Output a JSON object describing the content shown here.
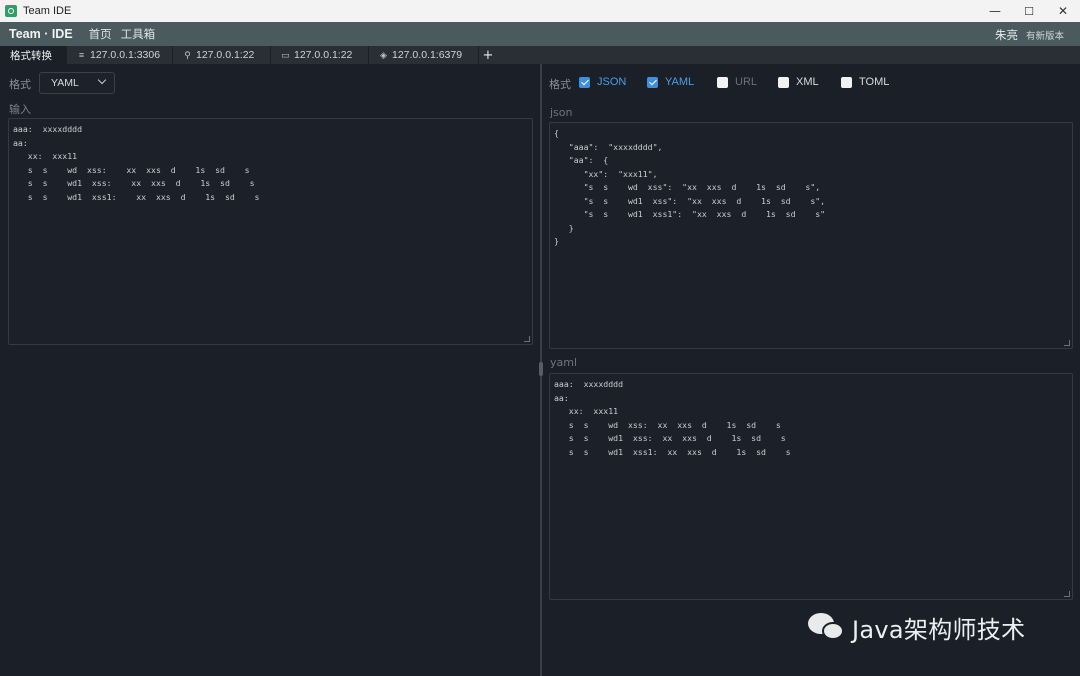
{
  "window": {
    "title": "Team IDE",
    "controls": {
      "minimize": "—",
      "maximize": "☐",
      "close": "✕"
    }
  },
  "appbar": {
    "brand": "Team · IDE",
    "nav": [
      "首页",
      "工具箱"
    ],
    "user": "朱亮",
    "update": "有新版本"
  },
  "tabs": [
    {
      "label": "格式转换",
      "icon": "",
      "active": true
    },
    {
      "label": "127.0.0.1:3306",
      "icon": "database-icon"
    },
    {
      "label": "127.0.0.1:22",
      "icon": "link-icon"
    },
    {
      "label": "127.0.0.1:22",
      "icon": "terminal-icon"
    },
    {
      "label": "127.0.0.1:6379",
      "icon": "cube-icon"
    }
  ],
  "tab_add": "+",
  "left": {
    "format_label": "格式",
    "format_value": "YAML",
    "input_label": "输入",
    "input_text": "aaa:  xxxxdddd\naa:\n   xx:  xxx11\n   s  s    wd  xss:    xx  xxs  d    1s  sd    s\n   s  s    wd1  xss:    xx  xxs  d    1s  sd    s\n   s  s    wd1  xss1:    xx  xxs  d    1s  sd    s"
  },
  "right": {
    "format_label": "格式",
    "options": [
      {
        "label": "JSON",
        "checked": true
      },
      {
        "label": "YAML",
        "checked": true
      },
      {
        "label": "URL",
        "checked": false,
        "dim": true
      },
      {
        "label": "XML",
        "checked": false
      },
      {
        "label": "TOML",
        "checked": false
      }
    ],
    "json_label": "json",
    "json_text": "{\n   \"aaa\":  \"xxxxdddd\",\n   \"aa\":  {\n      \"xx\":  \"xxx11\",\n      \"s  s    wd  xss\":  \"xx  xxs  d    1s  sd    s\",\n      \"s  s    wd1  xss\":  \"xx  xxs  d    1s  sd    s\",\n      \"s  s    wd1  xss1\":  \"xx  xxs  d    1s  sd    s\"\n   }\n}",
    "yaml_label": "yaml",
    "yaml_text": "aaa:  xxxxdddd\naa:\n   xx:  xxx11\n   s  s    wd  xss:  xx  xxs  d    1s  sd    s\n   s  s    wd1  xss:  xx  xxs  d    1s  sd    s\n   s  s    wd1  xss1:  xx  xxs  d    1s  sd    s"
  },
  "watermark": "Java架构师技术",
  "colors": {
    "accent": "#3d8fe0",
    "appbar": "#4b5a5f",
    "bg": "#1b1f27"
  }
}
